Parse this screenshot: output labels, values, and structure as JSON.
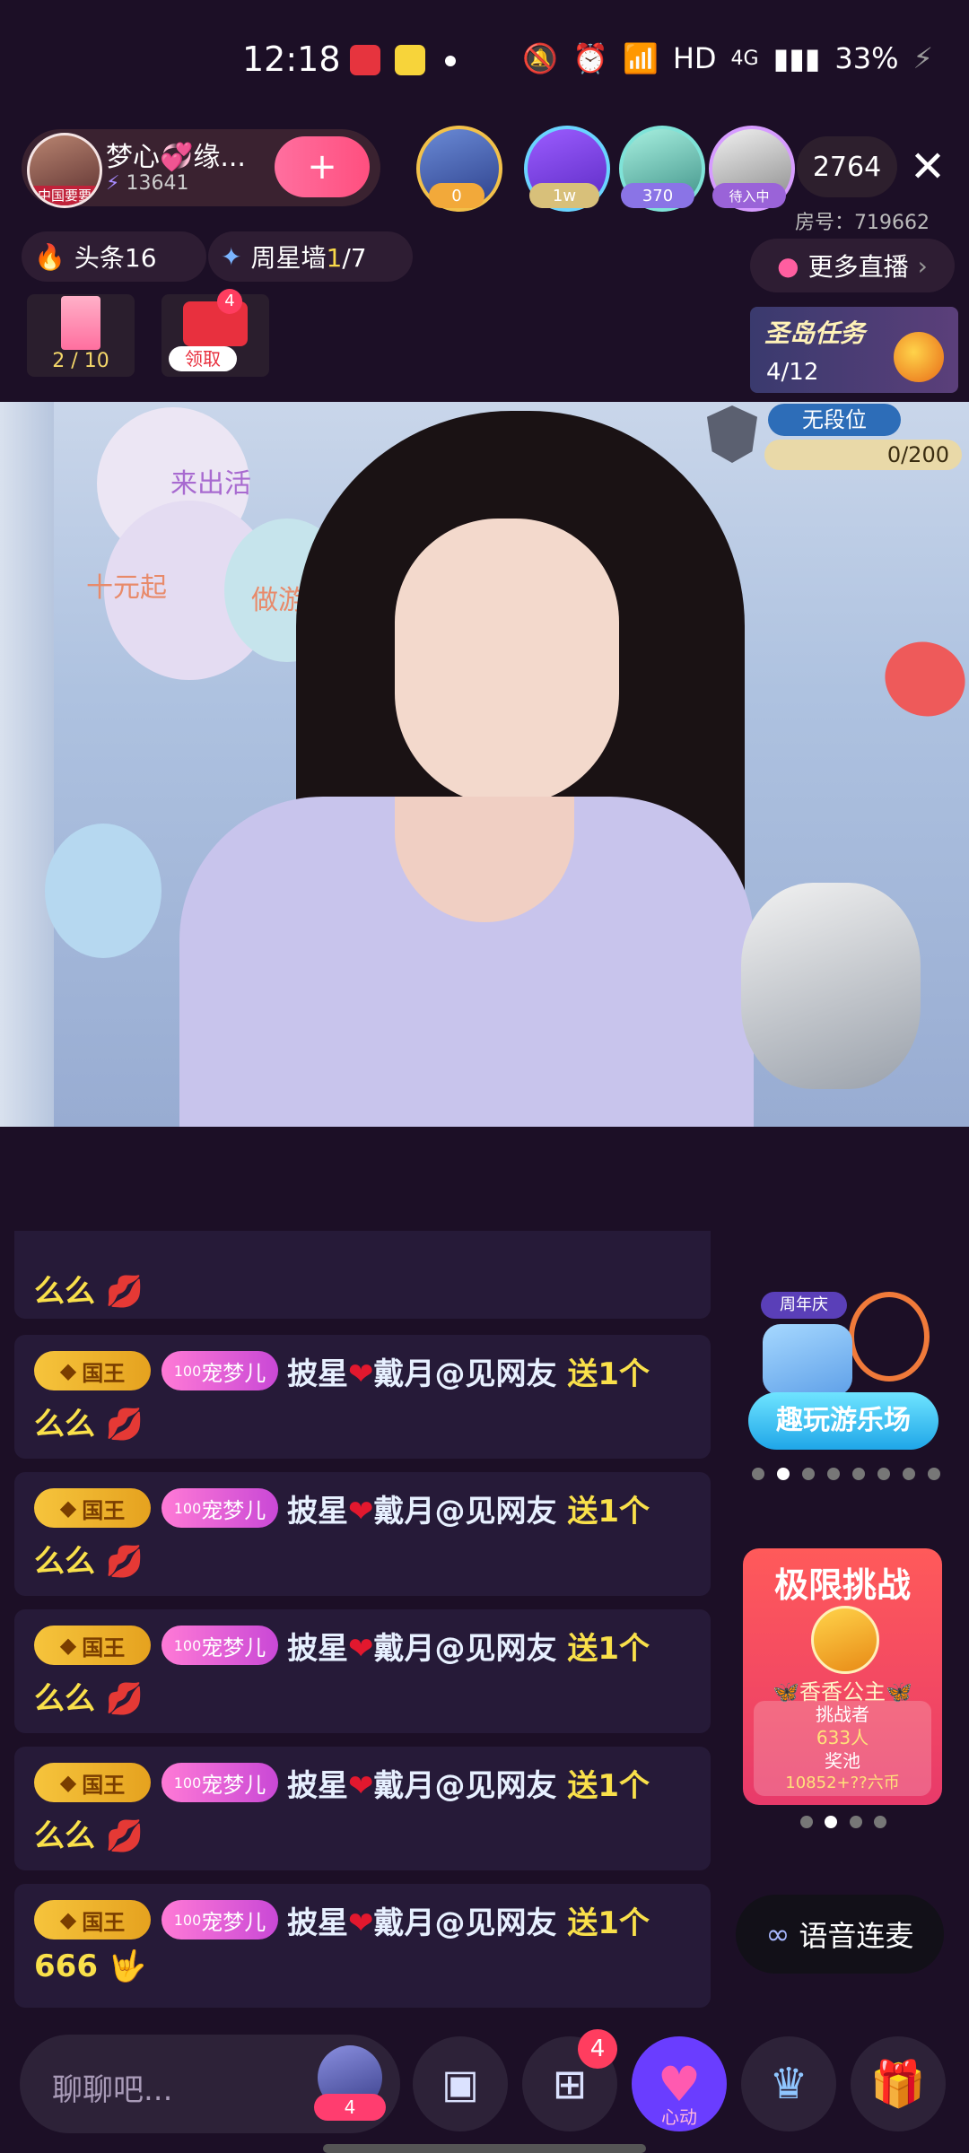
{
  "status_bar": {
    "time": "12:18",
    "network": "HD",
    "signal": "4G",
    "battery": "33%"
  },
  "anchor": {
    "name": "梦心💞缘...",
    "fans": "13641",
    "follow_icon": "+",
    "avatar_caption": "中国要要"
  },
  "viewers": [
    {
      "badge": "0"
    },
    {
      "badge": "1w"
    },
    {
      "badge": "370"
    },
    {
      "badge": "待入中"
    }
  ],
  "viewer_count": "2764",
  "room_id": "房号：719662",
  "row2": {
    "headline": "头条16",
    "weekly_star_prefix": "周星墙",
    "weekly_star_current": "1",
    "weekly_star_total": "/7",
    "more_live": "更多直播"
  },
  "activities": {
    "card_progress": "2 / 10",
    "redpack_badge": "4",
    "redpack_label": "领取",
    "island_task_title": "圣岛任务",
    "island_task_progress": "4/12"
  },
  "video": {
    "rank_label": "无段位",
    "rank_progress": "0/200",
    "balloon_texts": [
      "来出活",
      "十元起",
      "做游戏"
    ]
  },
  "chat": {
    "partial_line2": "么么",
    "messages": [
      {
        "king": "国王",
        "pet_level": "100",
        "pet": "宠梦儿",
        "user_a": "披星",
        "user_b": "戴月@见网友",
        "action": "送1个",
        "gift": "么么"
      },
      {
        "king": "国王",
        "pet_level": "100",
        "pet": "宠梦儿",
        "user_a": "披星",
        "user_b": "戴月@见网友",
        "action": "送1个",
        "gift": "么么"
      },
      {
        "king": "国王",
        "pet_level": "100",
        "pet": "宠梦儿",
        "user_a": "披星",
        "user_b": "戴月@见网友",
        "action": "送1个",
        "gift": "么么"
      },
      {
        "king": "国王",
        "pet_level": "100",
        "pet": "宠梦儿",
        "user_a": "披星",
        "user_b": "戴月@见网友",
        "action": "送1个",
        "gift": "么么"
      },
      {
        "king": "国王",
        "pet_level": "100",
        "pet": "宠梦儿",
        "user_a": "披星",
        "user_b": "戴月@见网友",
        "action": "送1个",
        "gift": "666"
      }
    ]
  },
  "side": {
    "anniversary": "周年庆",
    "amusement": "趣玩游乐场",
    "challenge_title": "极限挑战",
    "challenge_name": "🦋香香公主🦋",
    "challenger_label": "挑战者",
    "challenger_count": "633人",
    "pool_label": "奖池",
    "pool_value": "10852+??六币",
    "voice_link": "语音连麦"
  },
  "bottom": {
    "chat_placeholder": "聊聊吧...",
    "avatar_badge": "4",
    "apps_badge": "4",
    "heart_label": "心动"
  }
}
